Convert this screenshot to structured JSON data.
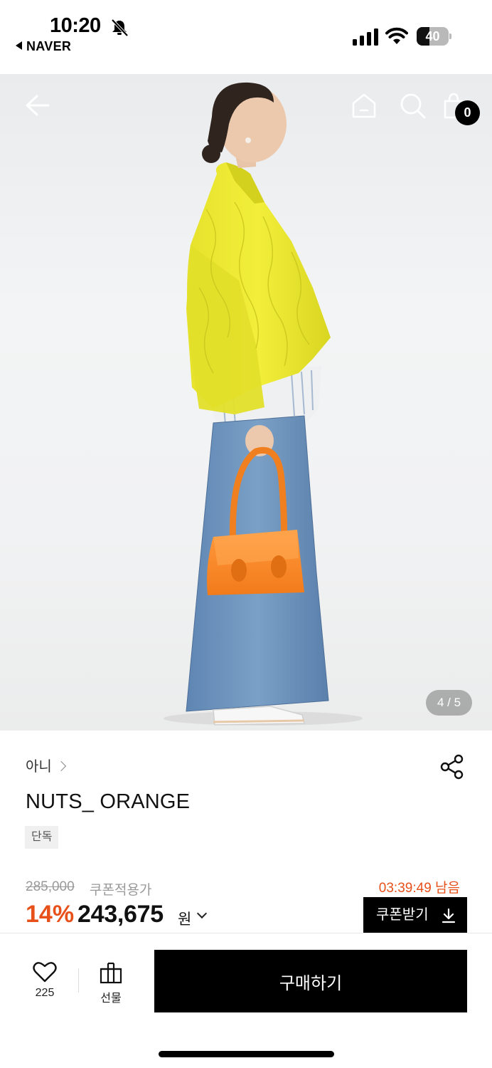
{
  "status_bar": {
    "time": "10:20",
    "back_app": "NAVER",
    "battery": "40",
    "battery_level": 0.4,
    "icons": [
      "bell-slash-icon",
      "signal-icon",
      "wifi-icon",
      "battery-icon"
    ]
  },
  "header": {
    "icons": [
      "back-arrow-icon",
      "home-icon",
      "search-icon",
      "shopping-bag-icon"
    ],
    "cart_count": "0"
  },
  "gallery": {
    "page_indicator": "4 / 5"
  },
  "product": {
    "brand": "아니",
    "title": "NUTS_ ORANGE",
    "badge": "단독",
    "original_price": "285,000",
    "coupon_price_label": "쿠폰적용가",
    "countdown": "03:39:49 남음",
    "discount": "14%",
    "price": "243,675",
    "price_unit": "원",
    "coupon_button_label": "쿠폰받기"
  },
  "bottom_bar": {
    "like_count": "225",
    "gift_label": "선물",
    "buy_label": "구매하기"
  },
  "colors": {
    "accent": "#e8501a",
    "primary": "#000000",
    "muted": "#999999"
  }
}
